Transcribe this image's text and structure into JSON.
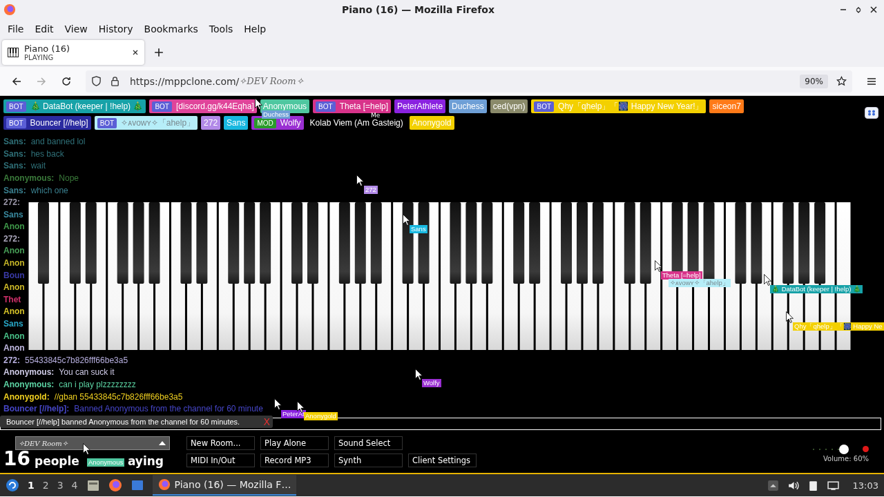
{
  "window": {
    "title": "Piano (16) — Mozilla Firefox"
  },
  "menu": [
    "File",
    "Edit",
    "View",
    "History",
    "Bookmarks",
    "Tools",
    "Help"
  ],
  "tabs": [
    {
      "title": "Piano (16)",
      "subtitle": "PLAYING",
      "selected": true
    }
  ],
  "address": {
    "url": "https://mppclone.com/",
    "room": "✧DEV Room✧",
    "zoom": "90%"
  },
  "users": [
    [
      {
        "name": "🎄 DataBot (keeper | !help) 🎄",
        "color": "#17a2a8",
        "tag": {
          "text": "BOT",
          "color": "#5b5fd6"
        }
      },
      {
        "name": "[discord.gg/k44Eqha]",
        "color": "#e0449a",
        "tag": {
          "text": "BOT",
          "color": "#5b5fd6"
        }
      },
      {
        "name": "Anonymous",
        "color": "#4fc7a0"
      },
      {
        "name": "Theta [=help]",
        "color": "#d8338a",
        "tag": {
          "text": "BOT",
          "color": "#5b5fd6"
        }
      },
      {
        "name": "PeterAthlete",
        "color": "#8a22e0"
      },
      {
        "name": "Duchess",
        "color": "#6e9fd6"
      },
      {
        "name": "ced(vpn)",
        "color": "#8a8a6a"
      },
      {
        "name": "Qhy「qhelp」「🎆 Happy New Year!」",
        "color": "#f3d000",
        "tag": {
          "text": "BOT",
          "color": "#5b5fd6"
        }
      },
      {
        "name": "siceon7",
        "color": "#ff7a18"
      }
    ],
    [
      {
        "name": "Bouncer [//help]",
        "color": "#2b2ba0",
        "tag": {
          "text": "BOT",
          "color": "#5b5fd6"
        }
      },
      {
        "name": "✧ᴀᴠᴏᴡʏ✧「ahelp」",
        "color": "#b6eef8",
        "tag": {
          "text": "BOT",
          "color": "#5b5fd6"
        }
      },
      {
        "name": "272",
        "color": "#b28ae8"
      },
      {
        "name": "Sans",
        "color": "#18b8e0"
      },
      {
        "name": "Wolfy",
        "color": "#9a2fd2",
        "tag": {
          "text": "MOD",
          "color": "#2a9a2a"
        }
      },
      {
        "name": "Kolab Viem (Am Gasteig)",
        "color": "#000000"
      },
      {
        "name": "Anonygold",
        "color": "#f3d000"
      }
    ]
  ],
  "chat": [
    {
      "name": "Sans:",
      "message": "and banned lol",
      "color": "#2f7078"
    },
    {
      "name": "Sans:",
      "message": "hes back",
      "color": "#2f7078"
    },
    {
      "name": "Sans:",
      "message": "wait",
      "color": "#2f7078"
    },
    {
      "name": "Anonymous:",
      "message": "Nope",
      "color": "#3a7a3a"
    },
    {
      "name": "Sans:",
      "message": "which one",
      "color": "#3a8090"
    },
    {
      "name": "272:",
      "color": "#9a96a8"
    },
    {
      "name": "Sans",
      "color": "#3a8aa0"
    },
    {
      "name": "Anon",
      "color": "#3f9a4a"
    },
    {
      "name": "272:",
      "color": "#a8a4b8"
    },
    {
      "name": "Anon",
      "color": "#48a058"
    },
    {
      "name": "Anon",
      "color": "#c8b828"
    },
    {
      "name": "Boun",
      "color": "#3a3aa8"
    },
    {
      "name": "Anon",
      "color": "#d0bc28"
    },
    {
      "name": "Thet",
      "color": "#d0306a"
    },
    {
      "name": "Anon",
      "color": "#d8c428"
    },
    {
      "name": "Sans",
      "color": "#28a8c8"
    },
    {
      "name": "Anon",
      "color": "#48c088"
    },
    {
      "name": "Anon",
      "color": "#c0b8e0"
    },
    {
      "name": "272:",
      "message": "55433845c7b826fff66be3a5",
      "color": "#b8b0e0"
    },
    {
      "name": "Anonymous:",
      "message": "You can suck it",
      "color": "#d0cce8"
    },
    {
      "name": "Anonymous:",
      "message": "can i play plzzzzzzzz",
      "color": "#5cd4a4"
    },
    {
      "name": "Anonygold:",
      "message": "//gban 55433845c7b826fff66be3a5",
      "color": "#f0d020"
    },
    {
      "name": "Bouncer [//help]:",
      "message": "Banned Anonymous from the channel for 60 minute",
      "color": "#4646c8"
    }
  ],
  "cursors": [
    {
      "kind": "cursor",
      "name": "Duchess",
      "color": "#6e9fd6"
    },
    {
      "kind": "plain",
      "name": "Me"
    },
    {
      "kind": "cursor",
      "name": "272",
      "color": "#b28ae8"
    },
    {
      "kind": "cursor",
      "name": "Sans",
      "color": "#18b8e0"
    },
    {
      "kind": "cursor",
      "name": "Theta [=help]",
      "color": "#d8338a"
    },
    {
      "kind": "label",
      "name": "✧ᴀᴠᴏᴡʏ✧「ahelp」",
      "color": "#b6eef8"
    },
    {
      "kind": "cursor",
      "name": "🎄 DataBot (keeper | !help) 🎄",
      "color": "#17a2a8"
    },
    {
      "kind": "cursor",
      "name": "Qhy「qhelp」「🎆 Happy Ne",
      "color": "#f3d000"
    },
    {
      "kind": "cursor",
      "name": "Wolfy",
      "color": "#9a2fd2"
    },
    {
      "kind": "cursor",
      "name": "PeterAt",
      "color": "#8a22e0"
    },
    {
      "kind": "cursor",
      "name": "Anonygold",
      "color": "#f3d000"
    },
    {
      "kind": "cursor",
      "name": "Anonymous",
      "color": "#4fc7a0"
    }
  ],
  "notification": {
    "text": "Bouncer [//help] banned Anonymous from the channel for 60 minutes.",
    "close": "X"
  },
  "room_select": {
    "value": "✧DEV Room✧"
  },
  "player_count": {
    "count": "16",
    "label": "people",
    "label_tail": "aying"
  },
  "buttons": [
    [
      "New Room...",
      "Play Alone",
      "Sound Select"
    ],
    [
      "MIDI In/Out",
      "Record MP3",
      "Synth",
      "Client Settings"
    ]
  ],
  "volume": {
    "level": 0.6,
    "label": "Volume: 60%"
  },
  "taskbar": {
    "workspaces": [
      {
        "label": "1",
        "selected": true
      },
      {
        "label": "2",
        "selected": false
      },
      {
        "label": "3",
        "selected": false
      },
      {
        "label": "4",
        "selected": false
      }
    ],
    "tasks": [
      {
        "title": "Piano (16) — Mozilla F…",
        "selected": true
      }
    ],
    "clock": "13:03"
  }
}
